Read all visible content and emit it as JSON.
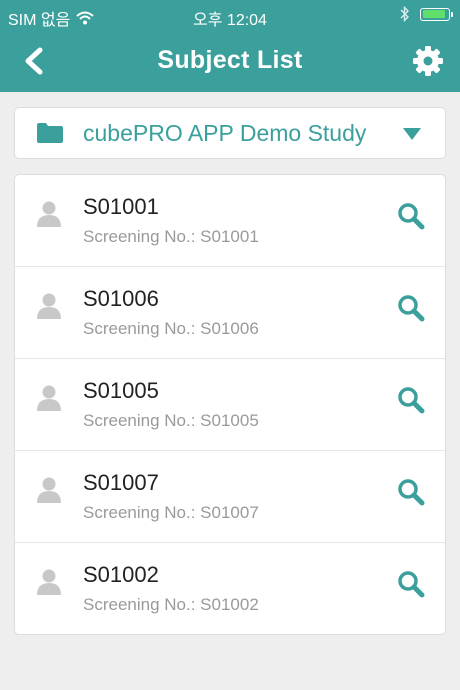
{
  "status_bar": {
    "carrier": "SIM 없음",
    "time": "오후 12:04",
    "battery_level": 0.95,
    "icons": [
      "wifi-icon",
      "bluetooth-icon",
      "battery-icon"
    ]
  },
  "nav": {
    "title": "Subject List",
    "back_icon": "chevron-left-icon",
    "settings_icon": "gear-icon"
  },
  "study_selector": {
    "label": "cubePRO APP Demo Study",
    "icon": "folder-icon",
    "dropdown_icon": "caret-down-icon"
  },
  "subjects": [
    {
      "id": "S01001",
      "screening": "Screening No.: S01001"
    },
    {
      "id": "S01006",
      "screening": "Screening No.: S01006"
    },
    {
      "id": "S01005",
      "screening": "Screening No.: S01005"
    },
    {
      "id": "S01007",
      "screening": "Screening No.: S01007"
    },
    {
      "id": "S01002",
      "screening": "Screening No.: S01002"
    }
  ],
  "colors": {
    "accent": "#3b9f9c",
    "background": "#eeeeee",
    "avatar": "#c8c8c8"
  }
}
